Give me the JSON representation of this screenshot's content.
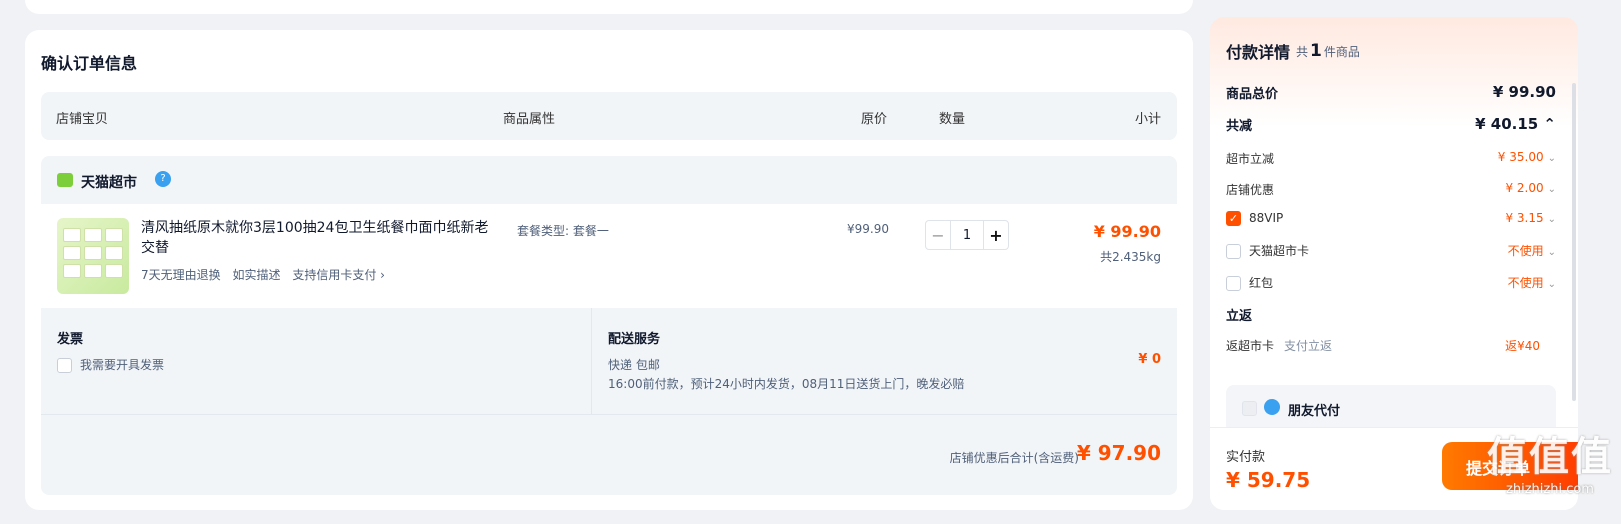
{
  "order": {
    "title": "确认订单信息",
    "headers": [
      "店铺宝贝",
      "商品属性",
      "原价",
      "数量",
      "小计"
    ],
    "shop_name": "天猫超市",
    "product": {
      "name": "清风抽纸原木就你3层100抽24包卫生纸餐巾面巾纸新老交替",
      "services": [
        "7天无理由退换",
        "如实描述",
        "支持信用卡支付 ›"
      ],
      "attr": "套餐类型: 套餐一",
      "orig_price": "¥99.90",
      "qty": "1",
      "subtotal": "¥ 99.90",
      "weight": "共2.435kg"
    },
    "invoice": {
      "title": "发票",
      "option": "我需要开具发票"
    },
    "shipping": {
      "title": "配送服务",
      "line1": "快递 包邮",
      "line2": "16:00前付款，预计24小时内发货，08月11日送货上门，晚发必赔",
      "fee": "¥ 0"
    },
    "total_label": "店铺优惠后合计(含运费)",
    "total_value": "¥ 97.90"
  },
  "payment": {
    "title": "付款详情",
    "count_prefix": "共",
    "count": "1",
    "count_suffix": "件商品",
    "rows": [
      {
        "label": "商品总价",
        "value": "¥ 99.90"
      },
      {
        "label": "共减",
        "value": "¥ 40.15 ⌃"
      },
      {
        "label": "超市立减",
        "value": "¥ 35.00"
      },
      {
        "label": "店铺优惠",
        "value": "¥ 2.00"
      },
      {
        "label": "88VIP",
        "value": "¥ 3.15"
      },
      {
        "label": "天猫超市卡",
        "value": "不使用"
      },
      {
        "label": "红包",
        "value": "不使用"
      },
      {
        "label": "立返",
        "value": ""
      },
      {
        "label": "返超市卡",
        "note": "支付立返",
        "value": "返¥40"
      }
    ],
    "friend_pay": "朋友代付",
    "pay_label": "实付款",
    "pay_value": "¥ 59.75",
    "submit": "提交订单"
  },
  "watermark": {
    "big": "值值值",
    "url": "zhizhizhi.com"
  },
  "colors": {
    "accent": "#ff5000",
    "bg": "#f1f2f5"
  }
}
